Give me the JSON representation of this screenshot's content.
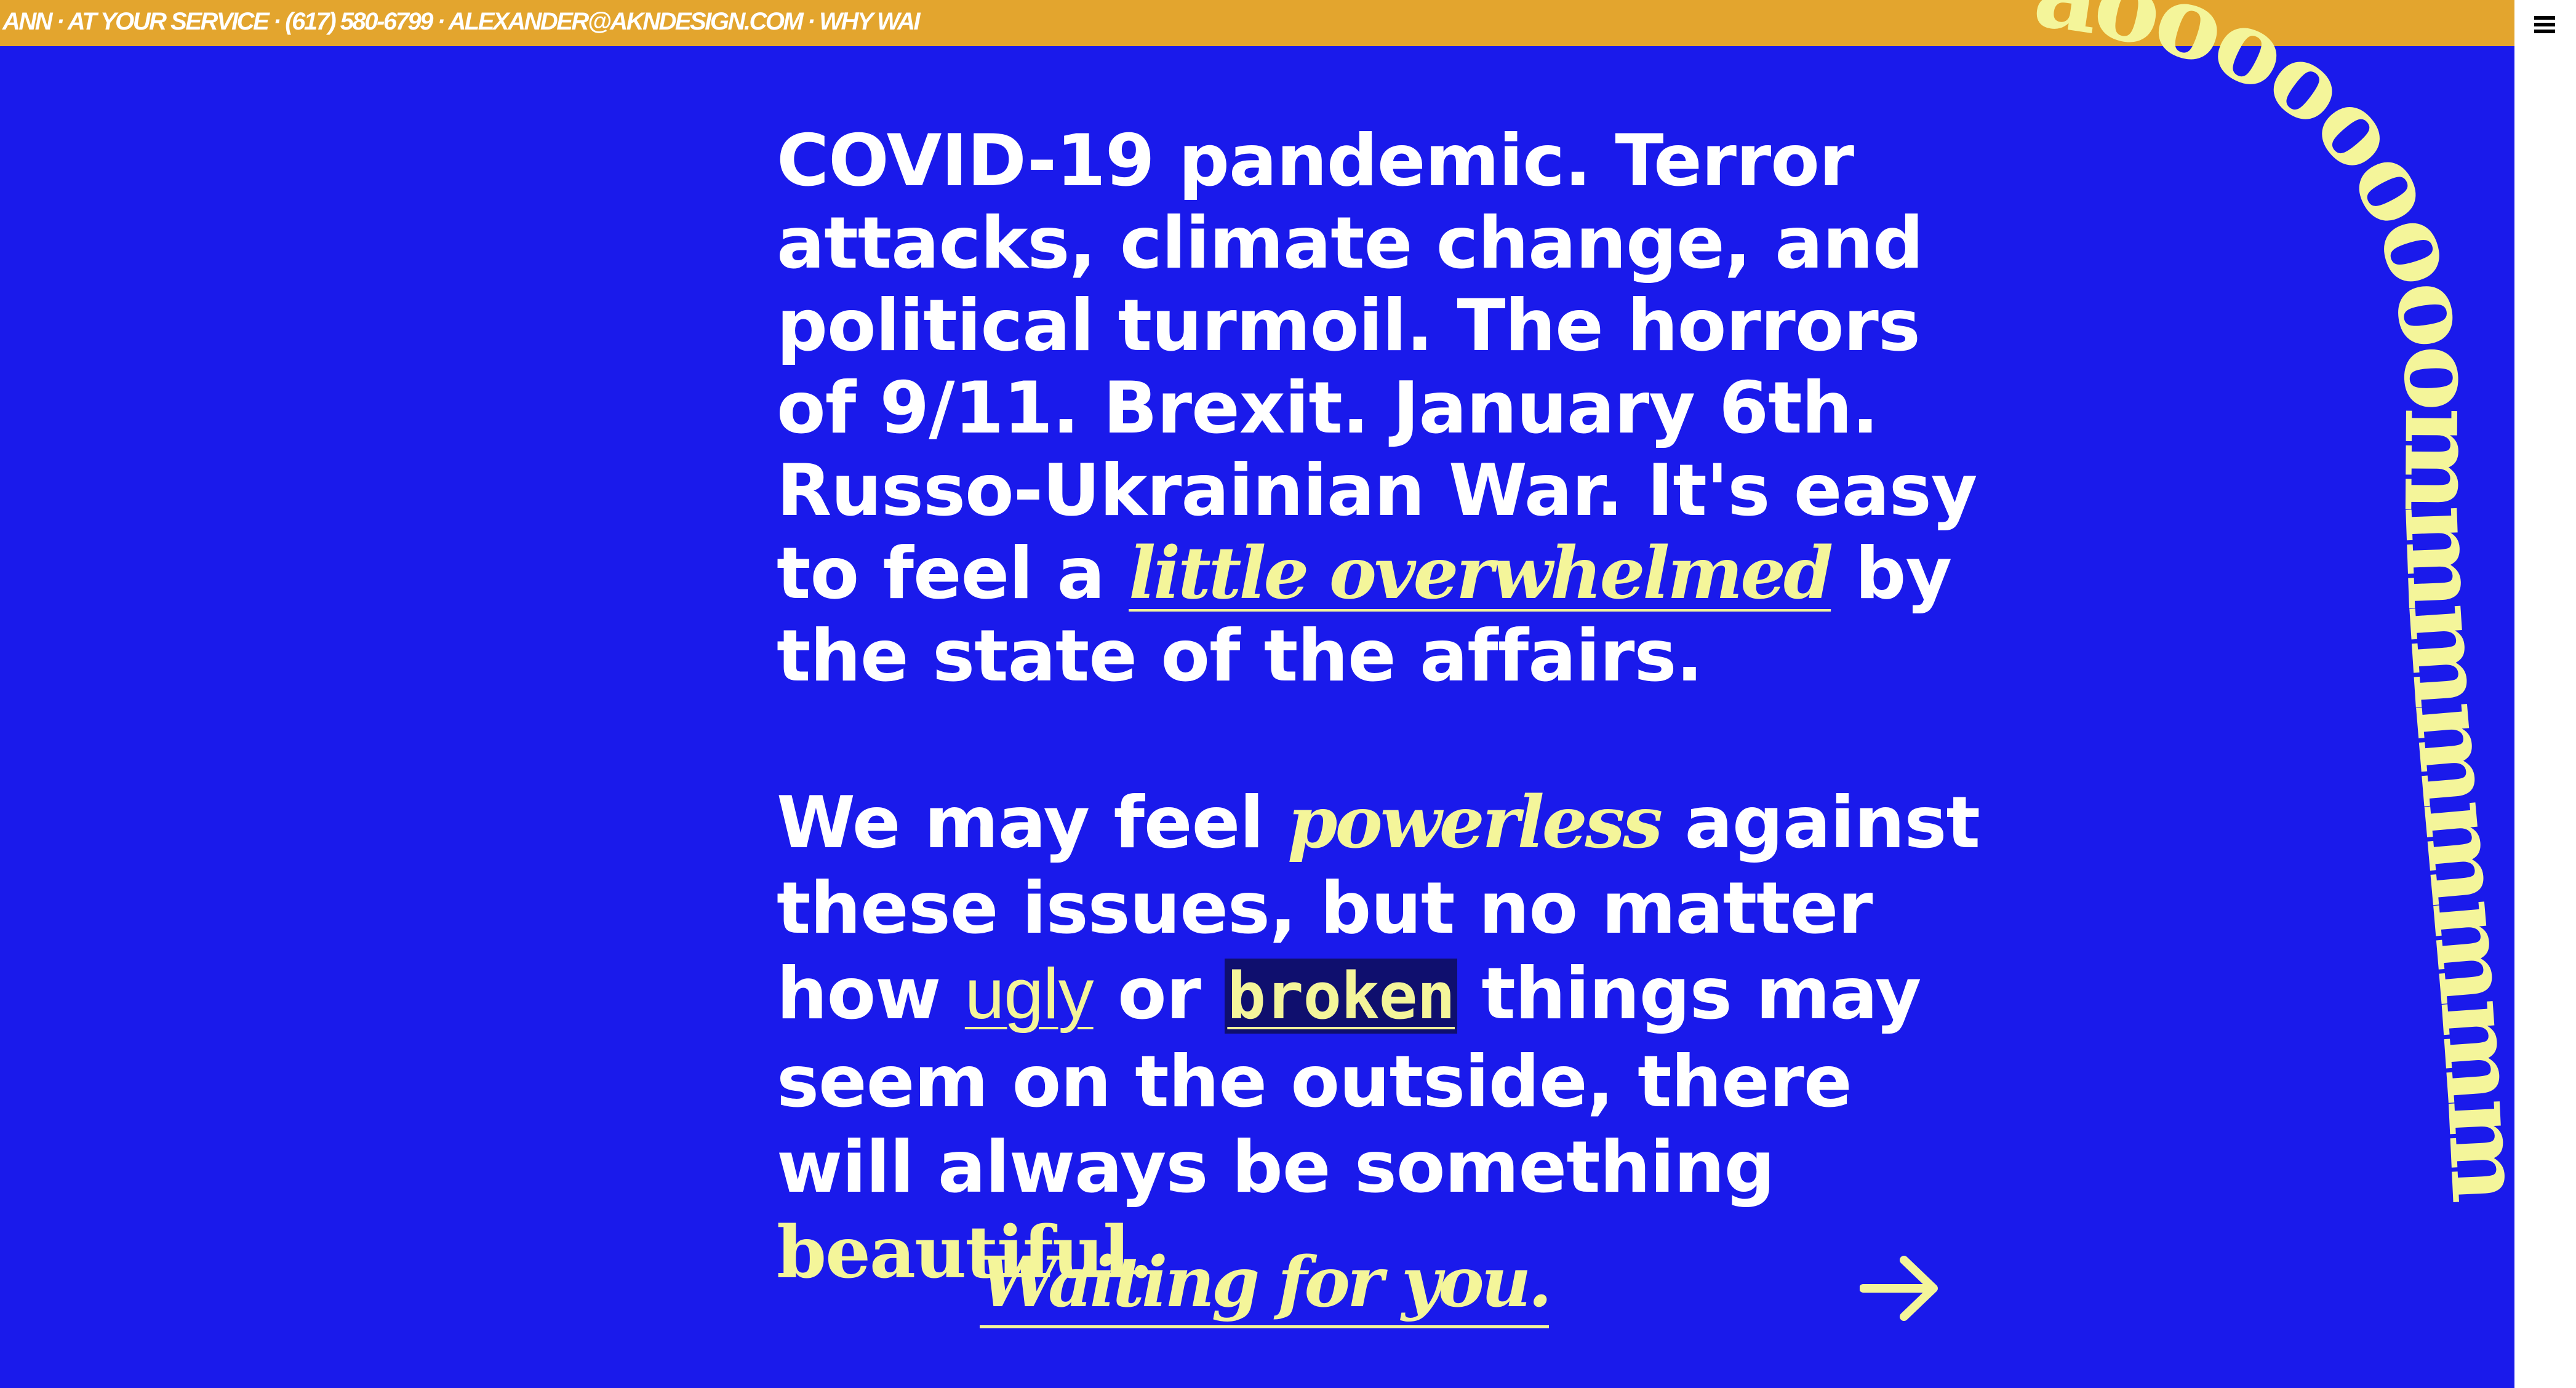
{
  "topbar": {
    "ticker": "ANN · AT YOUR SERVICE · (617) 580-6799 · ALEXANDER@AKNDESIGN.COM · WHY WAI"
  },
  "menu": {
    "icon": "hamburger-menu-icon"
  },
  "body_text": {
    "p1_before": "COVID-19 pandemic. Terror attacks, climate change, and political turmoil. The horrors of 9/11. Brexit. January 6th. Russo-Ukrainian War. It's easy to feel a ",
    "p1_emph": "little overwhelmed",
    "p1_after": " by the state of the affairs.",
    "p2_a": "We may feel ",
    "p2_powerless": "powerless",
    "p2_b": " against these issues, but no matter how ",
    "p2_ugly": "ugly",
    "p2_c": " or ",
    "p2_broken": "broken",
    "p2_d": " things may seem on the outside, there will always be something ",
    "p2_beautiful": "beautiful."
  },
  "cta": {
    "label": "Waiting for you.",
    "arrow_icon": "arrow-right-icon"
  },
  "decor": {
    "curve_text": "aooooooooommmmmmmm",
    "accent_color": "#f4f59a",
    "background_color": "#1a1aeb",
    "topbar_color": "#e3a52e"
  }
}
